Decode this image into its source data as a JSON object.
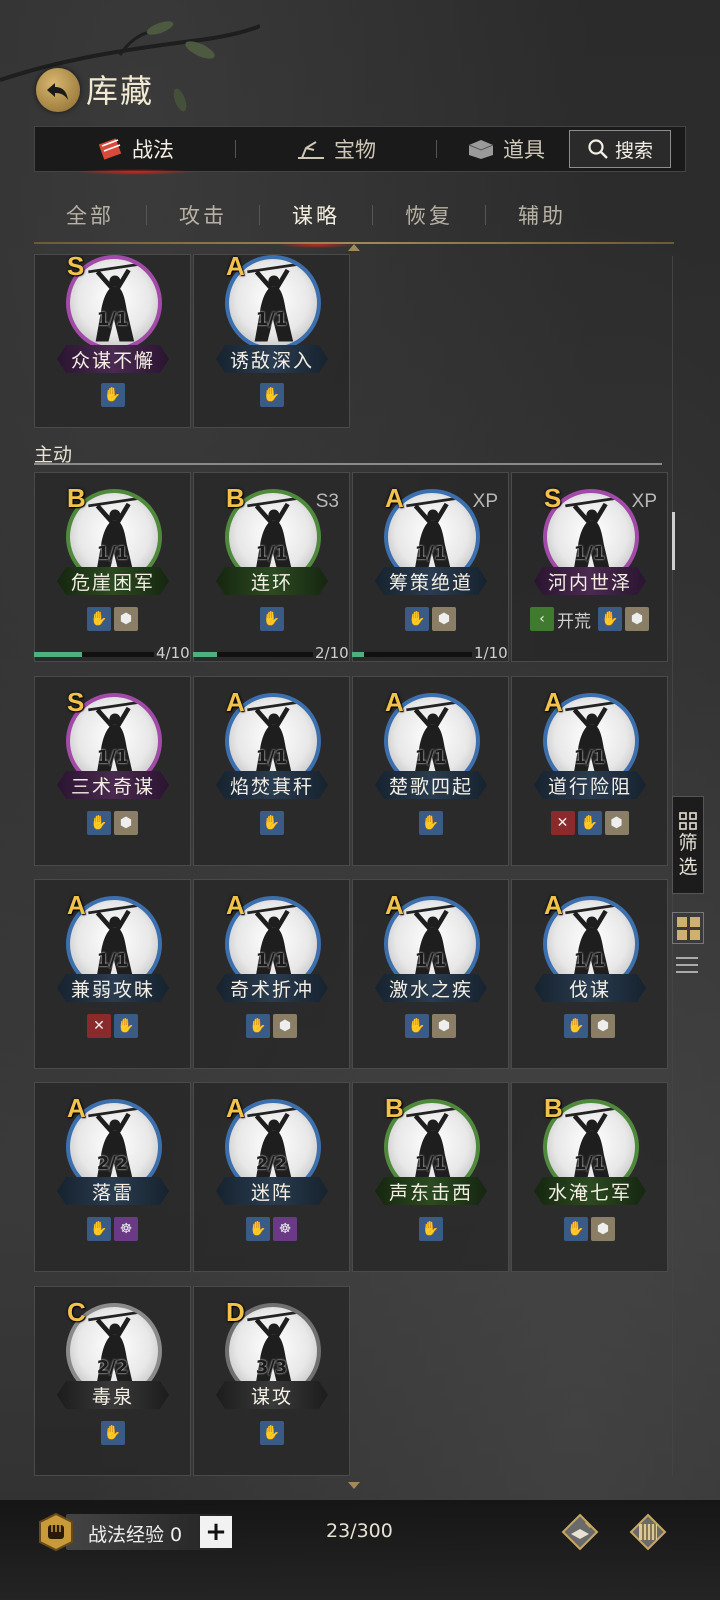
{
  "header": {
    "title": "库藏"
  },
  "main_tabs": [
    {
      "label": "战法",
      "active": true
    },
    {
      "label": "宝物",
      "active": false
    },
    {
      "label": "道具",
      "active": false
    }
  ],
  "search": {
    "label": "搜索"
  },
  "sub_tabs": [
    {
      "label": "全部",
      "active": false
    },
    {
      "label": "攻击",
      "active": false
    },
    {
      "label": "谋略",
      "active": true
    },
    {
      "label": "恢复",
      "active": false
    },
    {
      "label": "辅助",
      "active": false
    }
  ],
  "section": {
    "label": "主动"
  },
  "top_cards": [
    {
      "grade": "S",
      "count": "1/1",
      "name": "众谋不懈",
      "icons": [
        "blue"
      ]
    },
    {
      "grade": "A",
      "count": "1/1",
      "name": "诱敌深入",
      "icons": [
        "blue"
      ]
    }
  ],
  "cards": [
    {
      "grade": "B",
      "tag": "",
      "count": "1/1",
      "name": "危崖困军",
      "icons": [
        "blue",
        "tan"
      ],
      "progress": "4/10",
      "progress_value": 0.4
    },
    {
      "grade": "B",
      "tag": "S3",
      "count": "1/1",
      "name": "连环",
      "icons": [
        "blue"
      ],
      "progress": "2/10",
      "progress_value": 0.2
    },
    {
      "grade": "A",
      "tag": "XP",
      "count": "1/1",
      "name": "筹策绝道",
      "icons": [
        "blue",
        "tan"
      ],
      "progress": "1/10",
      "progress_value": 0.1
    },
    {
      "grade": "S",
      "tag": "XP",
      "count": "1/1",
      "name": "河内世泽",
      "icons": [
        "blue",
        "tan"
      ],
      "extra": "开荒"
    },
    {
      "grade": "S",
      "tag": "",
      "count": "1/1",
      "name": "三术奇谋",
      "icons": [
        "blue",
        "tan"
      ]
    },
    {
      "grade": "A",
      "tag": "",
      "count": "1/1",
      "name": "焰焚萁秆",
      "icons": [
        "blue"
      ]
    },
    {
      "grade": "A",
      "tag": "",
      "count": "1/1",
      "name": "楚歌四起",
      "icons": [
        "blue"
      ]
    },
    {
      "grade": "A",
      "tag": "",
      "count": "1/1",
      "name": "道行险阻",
      "icons": [
        "red",
        "blue",
        "tan"
      ]
    },
    {
      "grade": "A",
      "tag": "",
      "count": "1/1",
      "name": "兼弱攻昧",
      "icons": [
        "red",
        "blue"
      ]
    },
    {
      "grade": "A",
      "tag": "",
      "count": "1/1",
      "name": "奇术折冲",
      "icons": [
        "blue",
        "tan"
      ]
    },
    {
      "grade": "A",
      "tag": "",
      "count": "1/1",
      "name": "激水之疾",
      "icons": [
        "blue",
        "tan"
      ]
    },
    {
      "grade": "A",
      "tag": "",
      "count": "1/1",
      "name": "伐谋",
      "icons": [
        "blue",
        "tan"
      ]
    },
    {
      "grade": "A",
      "tag": "",
      "count": "2/2",
      "name": "落雷",
      "icons": [
        "blue",
        "purple"
      ]
    },
    {
      "grade": "A",
      "tag": "",
      "count": "2/2",
      "name": "迷阵",
      "icons": [
        "blue",
        "purple"
      ]
    },
    {
      "grade": "B",
      "tag": "",
      "count": "1/1",
      "name": "声东击西",
      "icons": [
        "blue"
      ]
    },
    {
      "grade": "B",
      "tag": "",
      "count": "1/1",
      "name": "水淹七军",
      "icons": [
        "blue",
        "tan"
      ]
    },
    {
      "grade": "C",
      "tag": "",
      "count": "2/2",
      "name": "毒泉",
      "icons": [
        "blue"
      ]
    },
    {
      "grade": "D",
      "tag": "",
      "count": "3/3",
      "name": "谋攻",
      "icons": [
        "blue"
      ]
    }
  ],
  "side": {
    "filter_label": "筛选"
  },
  "bottom": {
    "exp_label": "战法经验 0",
    "plus": "+",
    "capacity": "23/300"
  },
  "colors": {
    "accent_red": "#c7261e",
    "grade_gold": "#f2c24a",
    "progress_green": "#4eb07c"
  }
}
